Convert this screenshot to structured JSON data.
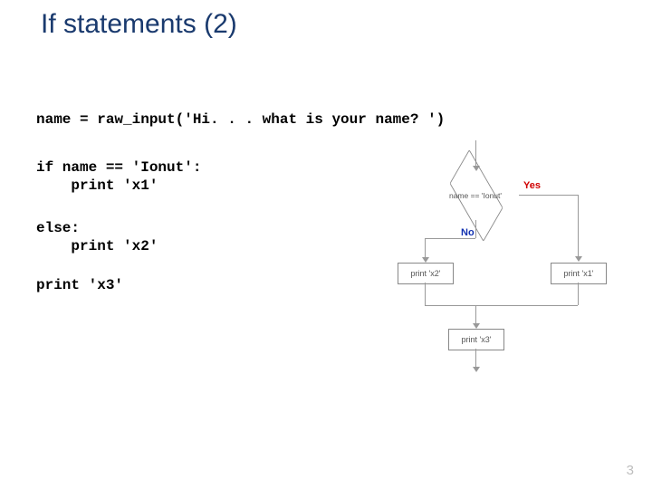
{
  "title": "If statements (2)",
  "code": {
    "line1": "name = raw_input('Hi. . . what is your name? ')",
    "line2": "if name == 'Ionut':\n    print 'x1'",
    "line3": "else:\n    print 'x2'",
    "line4": "print 'x3'"
  },
  "flow": {
    "condition": "name == 'Ionut'",
    "yes": "Yes",
    "no": "No",
    "box_x1": "print 'x1'",
    "box_x2": "print 'x2'",
    "box_x3": "print 'x3'"
  },
  "page": "3"
}
